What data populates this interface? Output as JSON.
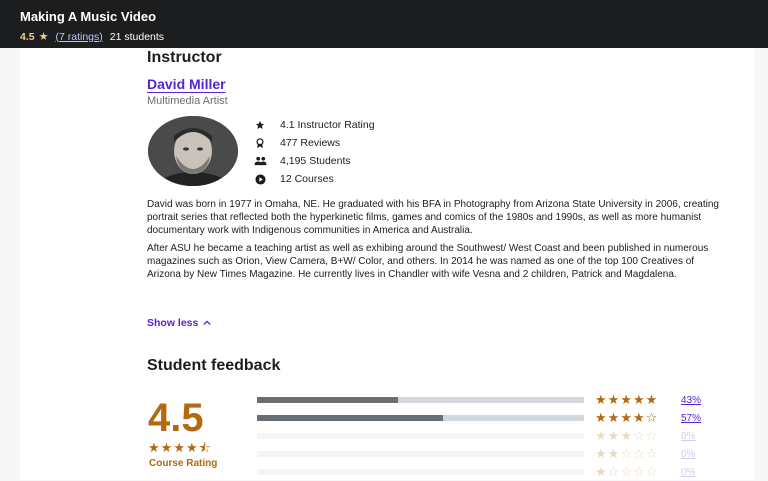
{
  "header": {
    "title": "Making A Music Video",
    "rating": "4.5",
    "ratings_link": "(7 ratings)",
    "students": "21 students"
  },
  "instructor": {
    "heading": "Instructor",
    "name": "David Miller",
    "job_title": "Multimedia Artist",
    "stats": [
      {
        "icon": "star-icon",
        "label": "4.1 Instructor Rating"
      },
      {
        "icon": "award-icon",
        "label": "477 Reviews"
      },
      {
        "icon": "users-icon",
        "label": "4,195 Students"
      },
      {
        "icon": "play-icon",
        "label": "12 Courses"
      }
    ],
    "bio": [
      "David was born in 1977 in Omaha, NE. He graduated with his BFA in Photography from Arizona State University in 2006, creating portrait series that reflected both the hyperkinetic films, games and comics of the 1980s and 1990s, as well as more humanist documentary work with Indigenous communities in America and Australia.",
      "After ASU he became a teaching artist as well as exhibing around the Southwest/ West Coast and been published in numerous magazines such as Orion, View Camera, B+W/ Color, and others. In 2014 he was named as one of the top 100 Creatives of Arizona by New Times Magazine. He currently lives in Chandler with wife Vesna and 2 children, Patrick and Magdalena."
    ],
    "show_less": "Show less"
  },
  "feedback": {
    "heading": "Student feedback",
    "rating": "4.5",
    "rating_label": "Course Rating",
    "rows": [
      {
        "stars": 5,
        "percent": "43%",
        "fill": 0.43
      },
      {
        "stars": 4,
        "percent": "57%",
        "fill": 0.57
      },
      {
        "stars": 3,
        "percent": "0%",
        "fill": 0
      },
      {
        "stars": 2,
        "percent": "0%",
        "fill": 0
      },
      {
        "stars": 1,
        "percent": "0%",
        "fill": 0
      }
    ]
  },
  "colors": {
    "header_bg": "#1c1d1f",
    "accent": "#5624d0",
    "rating": "#b4690e"
  }
}
